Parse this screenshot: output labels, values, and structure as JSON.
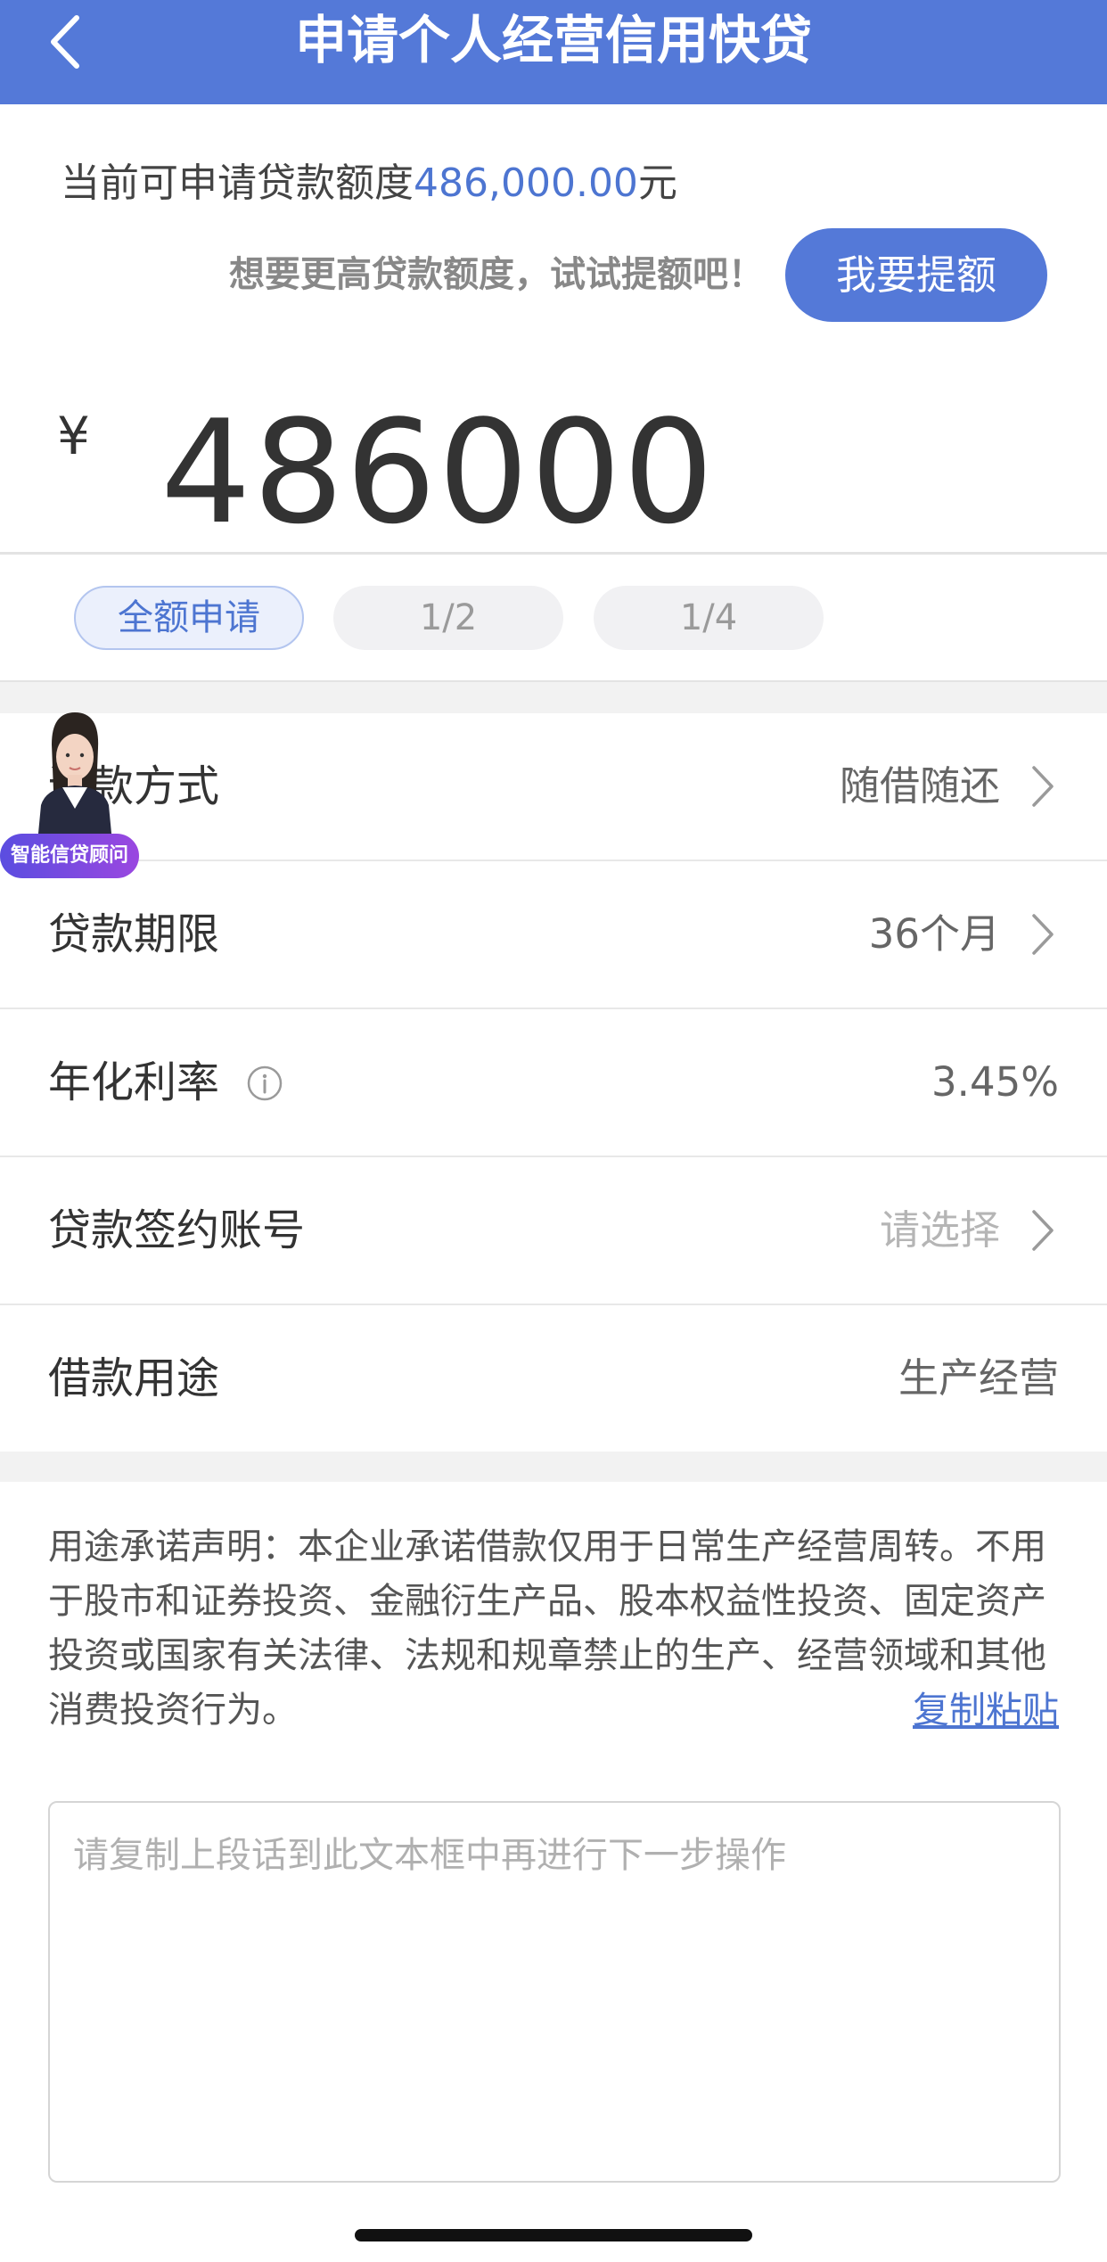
{
  "header": {
    "title": "申请个人经营信用快贷"
  },
  "quota": {
    "prefix": "当前可申请贷款额度",
    "amount": "486,000.00",
    "unit": "元"
  },
  "raise": {
    "hint": "想要更高贷款额度，试试提额吧！",
    "button": "我要提额"
  },
  "loan": {
    "currency": "¥",
    "amount": "486000"
  },
  "chips": [
    "全额申请",
    "1/2",
    "1/4"
  ],
  "advisor": {
    "badge": "智能信贷顾问"
  },
  "rows": [
    {
      "label": "还款方式",
      "value": "随借随还"
    },
    {
      "label": "贷款期限",
      "value": "36个月"
    },
    {
      "label": "年化利率",
      "value": "3.45%"
    },
    {
      "label": "贷款签约账号",
      "value": "请选择"
    },
    {
      "label": "借款用途",
      "value": "生产经营"
    }
  ],
  "statement": {
    "text": "用途承诺声明：本企业承诺借款仅用于日常生产经营周转。不用于股市和证券投资、金融衍生产品、股本权益性投资、固定资产投资或国家有关法律、法规和规章禁止的生产、经营领域和其他消费投资行为。",
    "copy_link": "复制粘贴"
  },
  "textbox": {
    "placeholder": "请复制上段话到此文本框中再进行下一步操作"
  }
}
